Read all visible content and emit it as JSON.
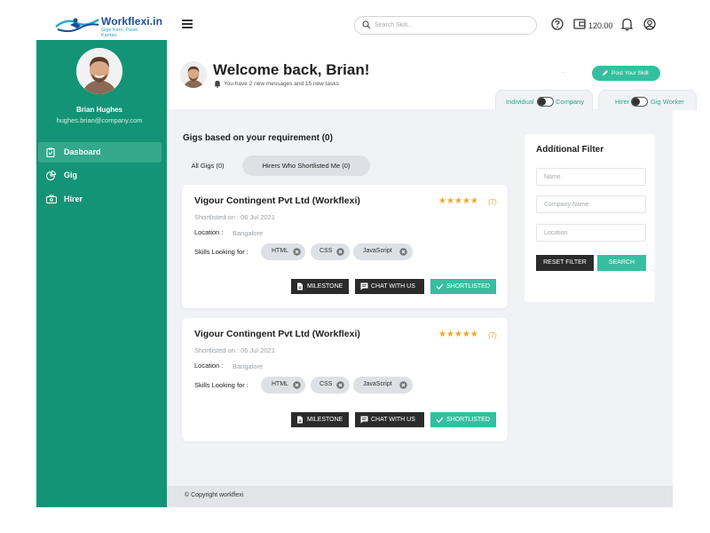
{
  "brand": {
    "name": "Workflexi.in",
    "tagline": "Gigs Karo, Paise Kamao"
  },
  "header": {
    "search_placeholder": "Search Skill...",
    "wallet_amount": "120.00"
  },
  "sidebar": {
    "user_name": "Brian Hughes",
    "user_email": "hughes.brian@company.com",
    "items": [
      {
        "label": "Dasboard",
        "icon": "clipboard-icon",
        "active": true
      },
      {
        "label": "Gig",
        "icon": "pie-chart-icon",
        "active": false
      },
      {
        "label": "Hirer",
        "icon": "briefcase-icon",
        "active": false
      }
    ]
  },
  "welcome": {
    "title": "Welcome back, Brian!",
    "subtitle": "You have 2 new messages and 15 new tasks",
    "post_button": "Post Your Skill"
  },
  "toggles": {
    "left": {
      "left": "Individual",
      "right": "Company"
    },
    "right": {
      "left": "Hirer",
      "right": "Gig Worker"
    }
  },
  "main": {
    "section_title": "Gigs based on your requirement (0)",
    "tabs": [
      {
        "label": "All Gigs (0)",
        "active": true
      },
      {
        "label": "Hirers Who Shortlisted Me (0)",
        "active": false
      }
    ],
    "skills_label": "Skills Looking for :",
    "location_label": "Location :",
    "cards": [
      {
        "company": "Vigour Contingent Pvt Ltd (Workflexi)",
        "stars": "★★★★★",
        "rating_count": "(7)",
        "shortlisted_on": "Shortlisted on : 06 Jul 2021",
        "location": "Bangalore",
        "skills": [
          "HTML",
          "CSS",
          "JavaScript"
        ],
        "buttons": {
          "milestone": "MILESTONE",
          "chat": "CHAT WITH US",
          "shortlisted": "SHORTLISTED"
        }
      },
      {
        "company": "Vigour Contingent Pvt Ltd (Workflexi)",
        "stars": "★★★★★",
        "rating_count": "(7)",
        "shortlisted_on": "Shortlisted on : 06 Jul 2021",
        "location": "Bangalore",
        "skills": [
          "HTML",
          "CSS",
          "JavaScript"
        ],
        "buttons": {
          "milestone": "MILESTONE",
          "chat": "CHAT WITH US",
          "shortlisted": "SHORTLISTED"
        }
      }
    ]
  },
  "filter": {
    "title": "Additional Filter",
    "name_placeholder": "Name",
    "company_placeholder": "Company Name",
    "location_placeholder": "Location",
    "reset_label": "RESET FILTER",
    "search_label": "SEARCH"
  },
  "footer": {
    "copyright": "© Copyright workflexi"
  },
  "colors": {
    "primary_green": "#139476",
    "accent_green": "#35bfa0",
    "star": "#f5a623",
    "dark_button": "#2b2b2b"
  }
}
